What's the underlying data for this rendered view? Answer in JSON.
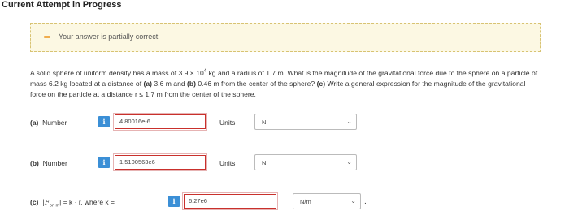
{
  "header": {
    "title": "Current Attempt in Progress"
  },
  "alert": {
    "message": "Your answer is partially correct."
  },
  "question": {
    "text_1": "A solid sphere of uniform density has a mass of 3.9 × 10",
    "exp_1": "4",
    "text_2": " kg and a radius of 1.7 m. What is the magnitude of the gravitational force due to the sphere on a particle of mass 6.2 kg located at a distance of ",
    "part_a_marker": "(a)",
    "text_3": " 3.6 m and ",
    "part_b_marker": "(b)",
    "text_4": " 0.46 m from the center of the sphere? ",
    "part_c_marker": "(c)",
    "text_5": " Write a general expression for the magnitude of the gravitational force on the particle at a distance r ≤ 1.7 m from the center of the sphere."
  },
  "part_a": {
    "marker": "(a)",
    "label": "Number",
    "info": "i",
    "value": "4.80016e-6",
    "units_label": "Units",
    "units_value": "N"
  },
  "part_b": {
    "marker": "(b)",
    "label": "Number",
    "info": "i",
    "value": "1.5100563e6",
    "units_label": "Units",
    "units_value": "N"
  },
  "part_c": {
    "marker": "(c)",
    "formula_lhs": "|F",
    "formula_sub": "on m",
    "formula_rhs": "| = k · r,  where k =",
    "info": "i",
    "value": "6.27e6",
    "units_value": "N/m",
    "trailing": "."
  },
  "icons": {
    "dropdown": "chevron-down-icon",
    "info": "info-icon",
    "alert": "minus-icon"
  },
  "colors": {
    "alert_bg": "#fcf8e3",
    "alert_accent": "#f0ad4e",
    "error_border": "#c9302c",
    "info_button": "#3b8fd6"
  }
}
